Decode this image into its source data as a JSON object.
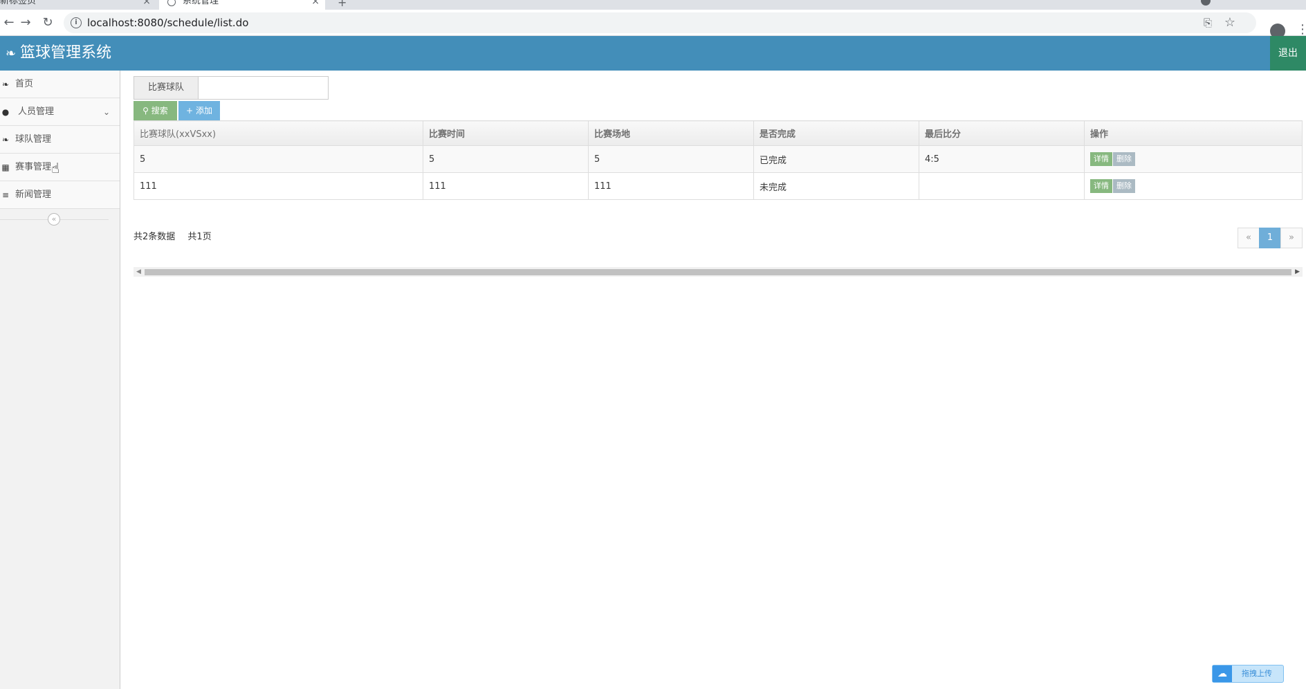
{
  "browser": {
    "tabs": [
      {
        "title": "新标签页"
      },
      {
        "title": "系统管理"
      }
    ],
    "url": "localhost:8080/schedule/list.do"
  },
  "header": {
    "brand": "篮球管理系统",
    "logout_label": "退出"
  },
  "sidebar": {
    "items": [
      {
        "label": "首页",
        "icon": "leaf-icon"
      },
      {
        "label": "人员管理",
        "icon": "user-icon",
        "expandable": true
      },
      {
        "label": "球队管理",
        "icon": "leaf-icon"
      },
      {
        "label": "赛事管理",
        "icon": "calendar-icon"
      },
      {
        "label": "新闻管理",
        "icon": "list-icon"
      }
    ]
  },
  "search": {
    "label": "比赛球队",
    "value": "",
    "search_label": "搜索",
    "add_label": "添加"
  },
  "table": {
    "columns": [
      "比赛球队(xxVSxx)",
      "比赛时间",
      "比赛场地",
      "是否完成",
      "最后比分",
      "操作"
    ],
    "rows": [
      {
        "team": "5",
        "time": "5",
        "venue": "5",
        "done": "已完成",
        "score": "4:5"
      },
      {
        "team": "111",
        "time": "111",
        "venue": "111",
        "done": "未完成",
        "score": ""
      }
    ],
    "detail_label": "详情",
    "delete_label": "删除"
  },
  "summary": {
    "total": "共2条数据",
    "pages": "共1页"
  },
  "pagination": {
    "prev": "«",
    "current": "1",
    "next": "»"
  },
  "upload": {
    "label": "拖拽上传"
  },
  "colors": {
    "header": "#438eb9",
    "logout": "#2e8965",
    "search_btn": "#87b87f",
    "add_btn": "#6fb3e0",
    "page_active": "#6faed9"
  }
}
